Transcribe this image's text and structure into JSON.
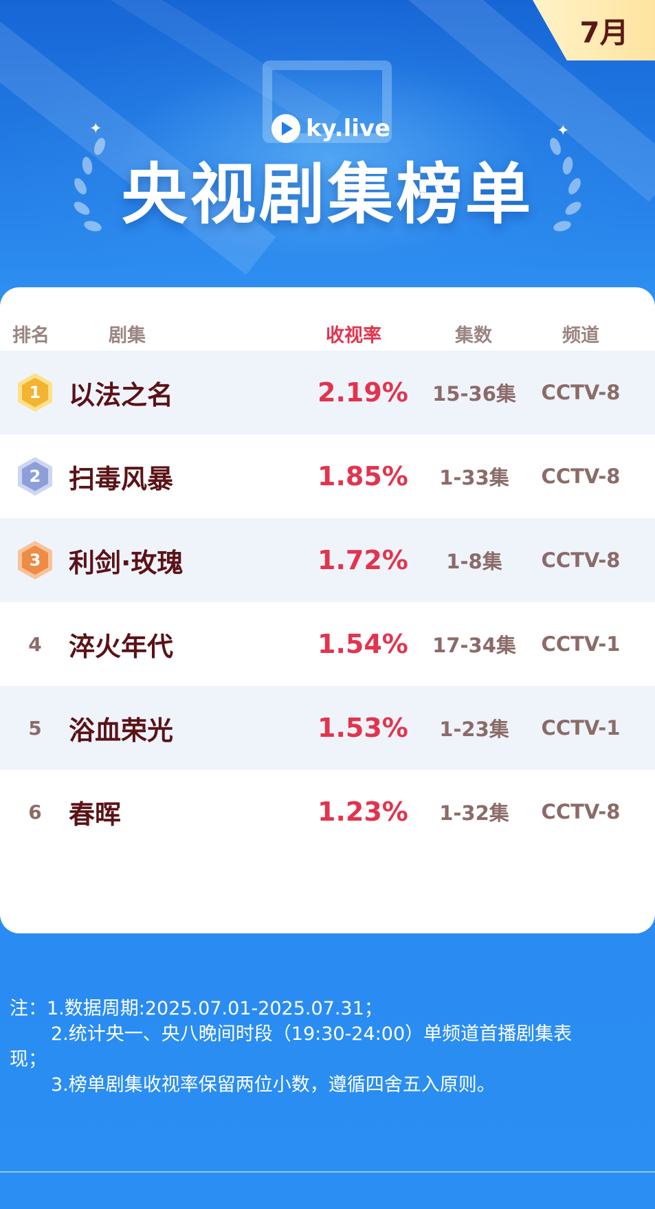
{
  "header": {
    "month_badge": "7月",
    "brand": "ky.live",
    "title": "央视剧集榜单"
  },
  "table": {
    "columns": {
      "rank": "排名",
      "drama": "剧集",
      "rating": "收视率",
      "episodes": "集数",
      "channel": "频道"
    },
    "rows": [
      {
        "rank": "1",
        "name": "以法之名",
        "rating": "2.19%",
        "episodes": "15-36集",
        "channel": "CCTV-8",
        "medal": "gold"
      },
      {
        "rank": "2",
        "name": "扫毒风暴",
        "rating": "1.85%",
        "episodes": "1-33集",
        "channel": "CCTV-8",
        "medal": "silver"
      },
      {
        "rank": "3",
        "name": "利剑·玫瑰",
        "rating": "1.72%",
        "episodes": "1-8集",
        "channel": "CCTV-8",
        "medal": "bronze"
      },
      {
        "rank": "4",
        "name": "淬火年代",
        "rating": "1.54%",
        "episodes": "17-34集",
        "channel": "CCTV-1"
      },
      {
        "rank": "5",
        "name": "浴血荣光",
        "rating": "1.53%",
        "episodes": "1-23集",
        "channel": "CCTV-1"
      },
      {
        "rank": "6",
        "name": "春晖",
        "rating": "1.23%",
        "episodes": "1-32集",
        "channel": "CCTV-8"
      }
    ]
  },
  "notes": {
    "line1": "注：1.数据周期:2025.07.01-2025.07.31；",
    "line2a": "2.统计央一、央八晚间时段（19:30-24:00）单频道首播剧集表",
    "line2b": "现；",
    "line3": "3.榜单剧集收视率保留两位小数，遵循四舍五入原则。"
  },
  "colors": {
    "background": "#2a8cf2",
    "rating_red": "#e2344e",
    "name_dark": "#5b1216",
    "muted": "#8b6b68",
    "gold": "#f2b431",
    "silver": "#8d9fd8",
    "bronze": "#ee8b45"
  },
  "icons": [
    "brand-logo-icon",
    "medal-hexagon-icon",
    "laurel-icon",
    "sparkle-icon"
  ]
}
